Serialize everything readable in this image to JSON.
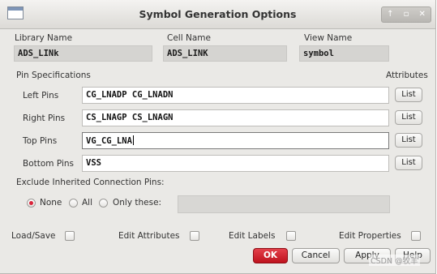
{
  "window": {
    "title": "Symbol Generation Options",
    "controls": [
      "↑",
      "▫",
      "✕"
    ]
  },
  "header": {
    "library_label": "Library Name",
    "library_value": "ADS_LINk",
    "cell_label": "Cell Name",
    "cell_value": "ADS_LINK",
    "view_label": "View Name",
    "view_value": "symbol"
  },
  "pins": {
    "section_label": "Pin Specifications",
    "attributes_label": "Attributes",
    "list_label": "List",
    "rows": [
      {
        "label": "Left Pins",
        "value": "CG_LNADP CG_LNADN"
      },
      {
        "label": "Right Pins",
        "value": "CS_LNAGP CS_LNAGN"
      },
      {
        "label": "Top Pins",
        "value": "VG_CG_LNA"
      },
      {
        "label": "Bottom Pins",
        "value": "VSS"
      }
    ]
  },
  "exclude": {
    "label": "Exclude Inherited Connection Pins:",
    "options": [
      "None",
      "All",
      "Only these:"
    ],
    "selected": "None",
    "only_these_value": ""
  },
  "checkboxes": [
    {
      "label": "Load/Save",
      "checked": false
    },
    {
      "label": "Edit Attributes",
      "checked": false
    },
    {
      "label": "Edit Labels",
      "checked": false
    },
    {
      "label": "Edit Properties",
      "checked": false
    }
  ],
  "buttons": {
    "ok": "OK",
    "cancel": "Cancel",
    "apply": "Apply",
    "help": "Help"
  },
  "watermark": "CSDN @牧羊",
  "colors": {
    "ok_button": "#d1202c",
    "radio_selected": "#d9243a",
    "window_bg": "#eae9e6"
  }
}
